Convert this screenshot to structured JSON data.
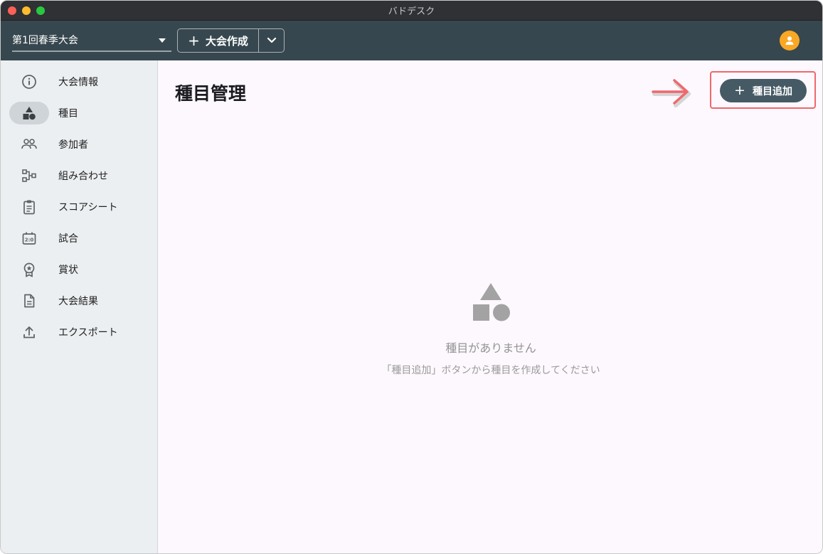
{
  "window": {
    "title": "バドデスク"
  },
  "appbar": {
    "tournament_selected": "第1回春季大会",
    "create_label": "大会作成"
  },
  "sidebar": {
    "items": [
      {
        "label": "大会情報",
        "icon": "info-icon",
        "active": false
      },
      {
        "label": "種目",
        "icon": "shapes-icon",
        "active": true
      },
      {
        "label": "参加者",
        "icon": "people-icon",
        "active": false
      },
      {
        "label": "組み合わせ",
        "icon": "bracket-icon",
        "active": false
      },
      {
        "label": "スコアシート",
        "icon": "clipboard-icon",
        "active": false
      },
      {
        "label": "試合",
        "icon": "scoreboard-icon",
        "active": false
      },
      {
        "label": "賞状",
        "icon": "award-icon",
        "active": false
      },
      {
        "label": "大会結果",
        "icon": "document-icon",
        "active": false
      },
      {
        "label": "エクスポート",
        "icon": "upload-icon",
        "active": false
      }
    ]
  },
  "main": {
    "title": "種目管理",
    "add_button_label": "種目追加",
    "empty_title": "種目がありません",
    "empty_description": "「種目追加」ボタンから種目を作成してください"
  },
  "colors": {
    "appbar": "#37474f",
    "sidebar": "#eceff1",
    "primary_button": "#455a64",
    "avatar": "#f9a825",
    "annotation": "#f0676d",
    "empty_icon": "#a3a3a3"
  }
}
